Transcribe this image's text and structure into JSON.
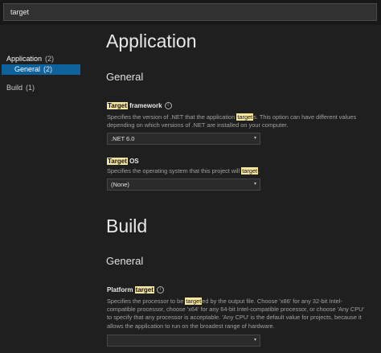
{
  "search": {
    "value": "target"
  },
  "sidebar": {
    "items": [
      {
        "label": "Application",
        "count": "(2)"
      },
      {
        "label": "General",
        "count": "(2)"
      },
      {
        "label": "Build",
        "count": "(1)"
      }
    ]
  },
  "sections": {
    "application": {
      "title": "Application",
      "subtitle": "General",
      "target_framework": {
        "label_hl": "Target",
        "label_rest": " framework",
        "desc_a": "Specifies the version of .NET that the application ",
        "desc_hl": "target",
        "desc_b": "s. This option can have different values depending on which versions of .NET are installed on your computer.",
        "value": ".NET 6.0"
      },
      "target_os": {
        "label_hl": "Target",
        "label_rest": " OS",
        "desc_a": "Specifies the operating system that this project will ",
        "desc_hl": "target",
        "desc_b": ".",
        "value": "(None)"
      }
    },
    "build": {
      "title": "Build",
      "subtitle": "General",
      "platform_target": {
        "label_a": "Platform ",
        "label_hl": "target",
        "desc_a": "Specifies the processor to be ",
        "desc_hl": "target",
        "desc_b": "ed by the output file. Choose 'x86' for any 32-bit Intel-compatible processor, choose 'x64' for any 64-bit Intel-compatible processor, or choose 'Any CPU' to specify that any processor is acceptable. 'Any CPU' is the default value for projects, because it allows the application to run on the broadest range of hardware.",
        "value": ""
      }
    }
  },
  "icons": {
    "info": "info-circle-icon",
    "dropdown": "chevron-down-icon"
  }
}
